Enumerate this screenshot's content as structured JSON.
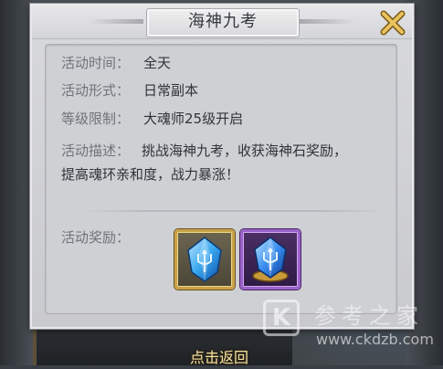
{
  "dialog": {
    "title": "海神九考",
    "fields": [
      {
        "label": "活动时间：",
        "value": "全天"
      },
      {
        "label": "活动形式：",
        "value": "日常副本"
      },
      {
        "label": "等级限制：",
        "value": "大魂师25级开启"
      }
    ],
    "description": {
      "label": "活动描述：",
      "line1": "挑战海神九考，收获海神石奖励，",
      "line2": "提高魂环亲和度，战力暴涨！"
    },
    "rewards": {
      "label": "活动奖励：",
      "items": [
        {
          "icon": "blue-trident-crystal-icon",
          "frame": "gold"
        },
        {
          "icon": "blue-trident-crystal-on-gold-base-icon",
          "frame": "purple"
        }
      ]
    }
  },
  "bottom_button": "点击返回",
  "watermark": {
    "logo_letter": "K",
    "text": "参考之家",
    "url": "www.ckdzb.com"
  },
  "colors": {
    "gold_frame": "#c9a24a",
    "purple_frame": "#9a63c9",
    "crystal_blue": "#3aa8f0"
  }
}
